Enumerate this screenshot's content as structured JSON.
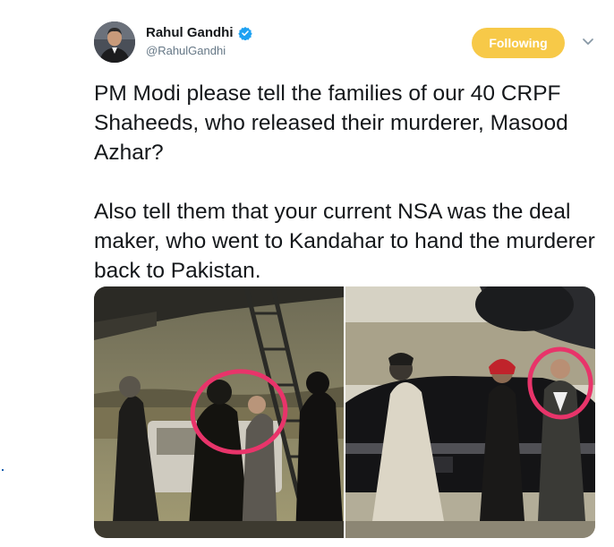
{
  "author": {
    "name": "Rahul Gandhi",
    "handle": "@RahulGandhi",
    "verified_icon": "verified-badge-icon",
    "avatar_icon": "profile-photo"
  },
  "follow_button": {
    "label": "Following",
    "color": "#f7c948"
  },
  "menu_icon": "chevron-down-icon",
  "tweet": {
    "paragraphs": [
      "PM Modi please tell the families of our 40 CRPF Shaheeds, who released their murderer, Masood Azhar?",
      "Also tell them that your current NSA was the deal maker, who went to Kandahar to hand the murderer back to Pakistan."
    ]
  },
  "media": {
    "photos": [
      {
        "name": "photo-left",
        "description_icon": "tarmac-ladder-photo",
        "annotation_color": "#e8346a"
      },
      {
        "name": "photo-right",
        "description_icon": "tarmac-car-photo",
        "annotation_color": "#e8346a"
      }
    ]
  },
  "colors": {
    "text": "#14171a",
    "muted": "#657786",
    "verified": "#1da1f2"
  }
}
